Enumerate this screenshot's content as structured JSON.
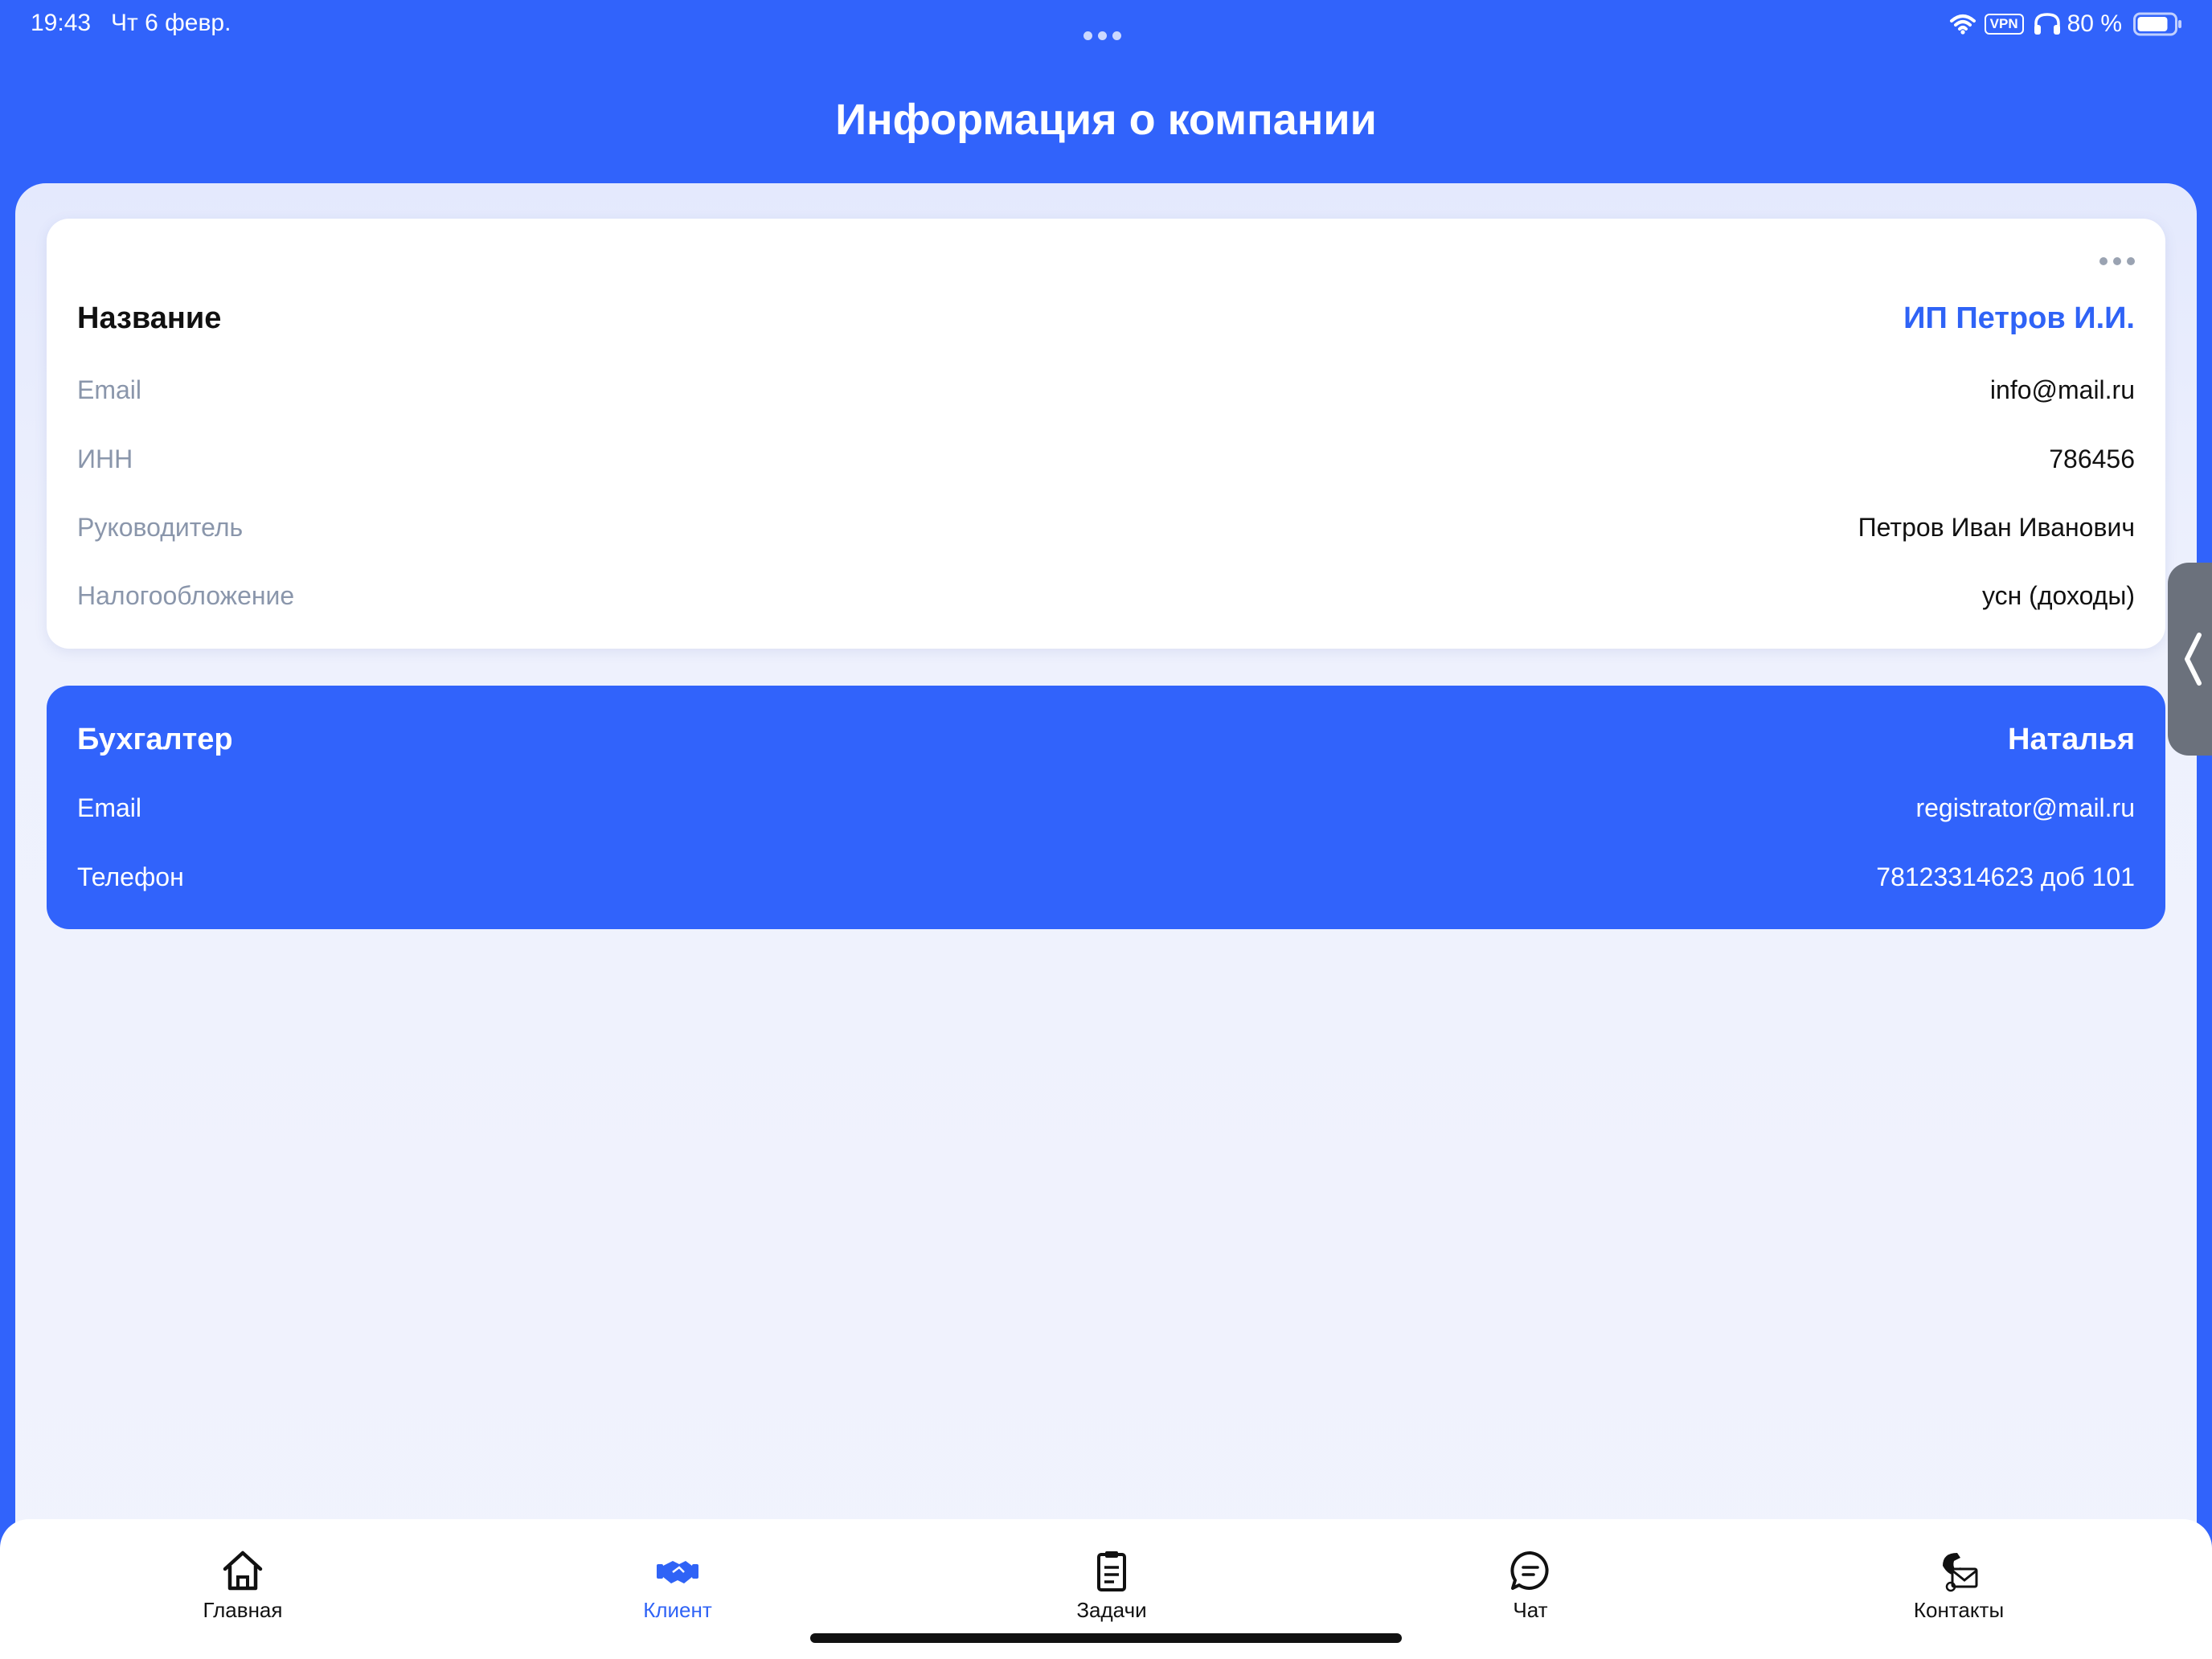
{
  "status_bar": {
    "time": "19:43",
    "date": "Чт 6 февр.",
    "vpn": "VPN",
    "battery": "80 %"
  },
  "header": {
    "title": "Информация о компании"
  },
  "company_card": {
    "title_label": "Название",
    "title_value": "ИП Петров И.И.",
    "rows": [
      {
        "label": "Email",
        "value": "info@mail.ru"
      },
      {
        "label": "ИНН",
        "value": "786456"
      },
      {
        "label": "Руководитель",
        "value": "Петров Иван Иванович"
      },
      {
        "label": "Налогообложение",
        "value": "усн (доходы)"
      }
    ]
  },
  "accountant_card": {
    "title_label": "Бухгалтер",
    "title_value": "Наталья",
    "rows": [
      {
        "label": "Email",
        "value": "registrator@mail.ru"
      },
      {
        "label": "Телефон",
        "value": "78123314623 доб 101"
      }
    ]
  },
  "tabs": [
    {
      "label": "Главная",
      "icon": "home-icon",
      "active": false
    },
    {
      "label": "Клиент",
      "icon": "handshake-icon",
      "active": true
    },
    {
      "label": "Задачи",
      "icon": "clipboard-icon",
      "active": false
    },
    {
      "label": "Чат",
      "icon": "chat-bubble-icon",
      "active": false
    },
    {
      "label": "Контакты",
      "icon": "contacts-icon",
      "active": false
    }
  ],
  "colors": {
    "brand_blue": "#3163fb",
    "accent_text": "#2f63f6",
    "muted_label": "#8a96ab"
  }
}
